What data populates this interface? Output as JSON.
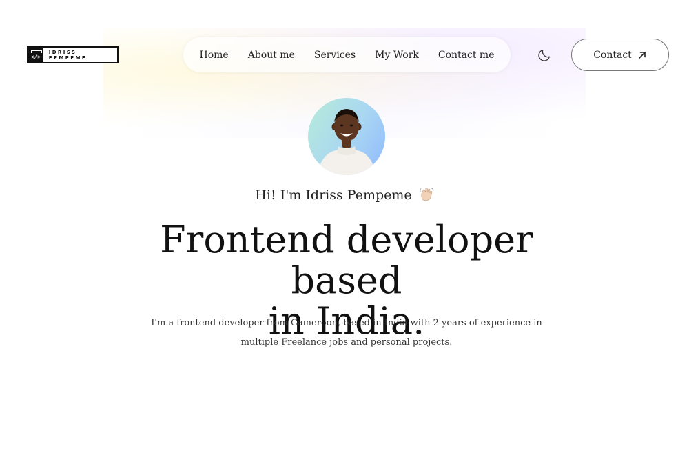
{
  "brand": {
    "logo_text": "IDRISS PEMPEME",
    "logo_mark": "</>"
  },
  "nav": {
    "items": [
      {
        "label": "Home"
      },
      {
        "label": "About me"
      },
      {
        "label": "Services"
      },
      {
        "label": "My Work"
      },
      {
        "label": "Contact me"
      }
    ]
  },
  "header": {
    "theme_toggle_icon": "moon-icon",
    "contact_button": {
      "label": "Contact",
      "icon": "arrow-up-right-icon"
    }
  },
  "hero": {
    "avatar_icon": "profile-photo",
    "greeting": "Hi! I'm Idriss Pempeme",
    "greeting_icon": "waving-hand-icon",
    "headline_line1": "Frontend developer based",
    "headline_line2": "in India.",
    "intro": "I'm a frontend developer from Cameroon, based in India with 2 years of experience in multiple Freelance jobs and personal projects."
  },
  "colors": {
    "text": "#111111",
    "avatar_gradient_start": "#b7ecd9",
    "avatar_gradient_end": "#8fb9ff",
    "button_border": "#777777"
  }
}
